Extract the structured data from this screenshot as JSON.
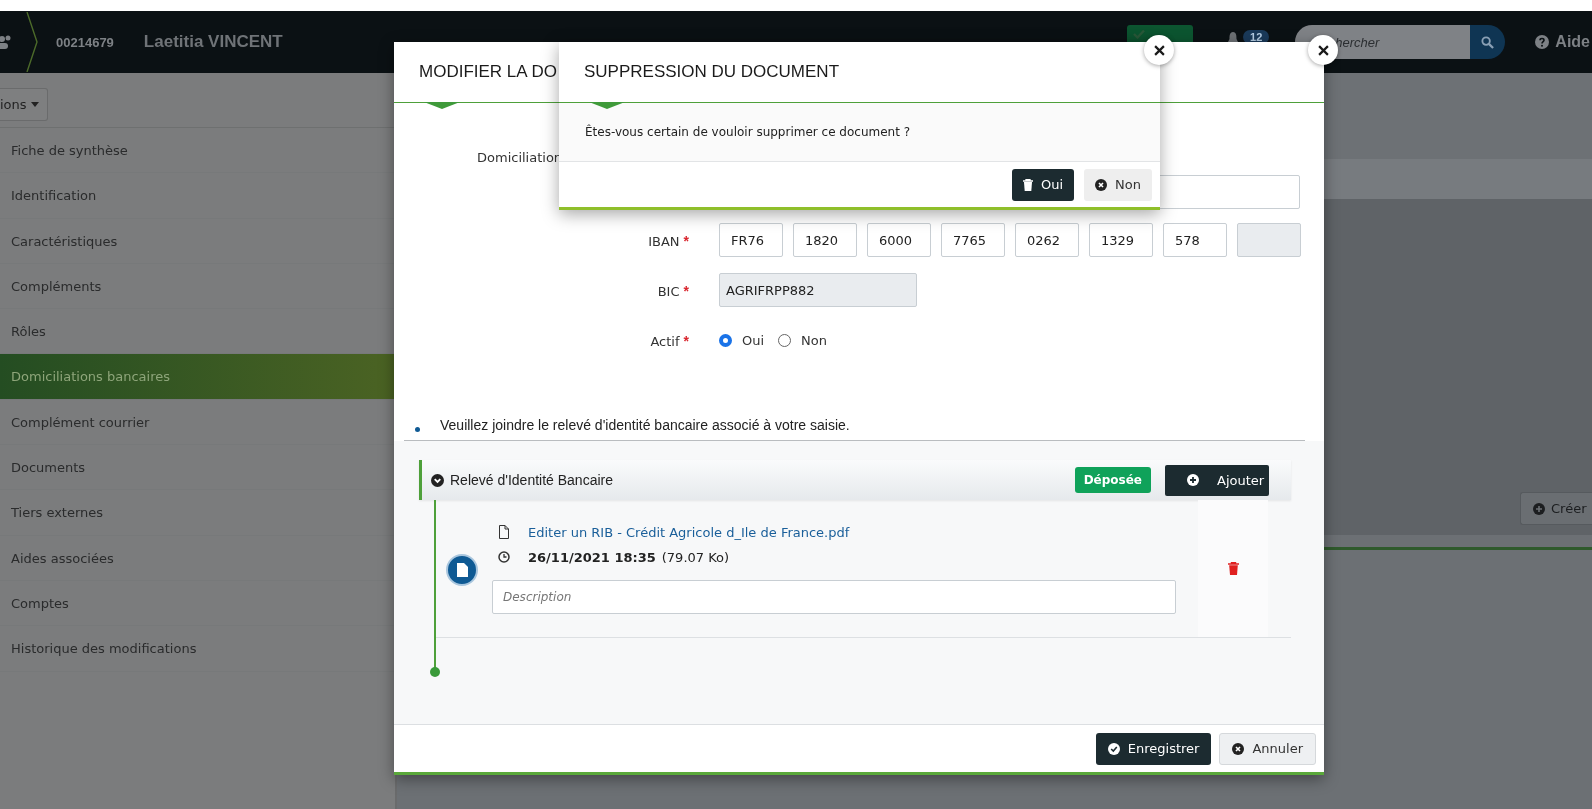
{
  "header": {
    "record_id": "00214679",
    "name": "Laetitia VINCENT",
    "notification_count": "12",
    "search": {
      "placeholder": "hercher"
    },
    "help": "Aide"
  },
  "toolbar": {
    "actions_button": "ions"
  },
  "sidebar": {
    "items": [
      {
        "label": "Fiche de synthèse",
        "selected": false
      },
      {
        "label": "Identification",
        "selected": false
      },
      {
        "label": "Caractéristiques",
        "selected": false
      },
      {
        "label": "Compléments",
        "selected": false
      },
      {
        "label": "Rôles",
        "selected": false
      },
      {
        "label": "Domiciliations bancaires",
        "selected": true
      },
      {
        "label": "Complément courrier",
        "selected": false
      },
      {
        "label": "Documents",
        "selected": false
      },
      {
        "label": "Tiers externes",
        "selected": false
      },
      {
        "label": "Aides associées",
        "selected": false
      },
      {
        "label": "Comptes",
        "selected": false
      },
      {
        "label": "Historique des modifications",
        "selected": false
      }
    ]
  },
  "background_panel": {
    "create_button": "Créer"
  },
  "edit_modal": {
    "title": "MODIFIER LA DO",
    "domiciliation": {
      "label": "Domiciliation"
    },
    "iban": {
      "label": "IBAN",
      "required_mark": "*",
      "parts": [
        {
          "value": "FR76",
          "disabled": false
        },
        {
          "value": "1820",
          "disabled": false
        },
        {
          "value": "6000",
          "disabled": false
        },
        {
          "value": "7765",
          "disabled": false
        },
        {
          "value": "0262",
          "disabled": false
        },
        {
          "value": "1329",
          "disabled": false
        },
        {
          "value": "578",
          "disabled": false
        },
        {
          "disabled": true
        }
      ]
    },
    "bic": {
      "label": "BIC",
      "required_mark": "*",
      "value": "AGRIFRPP882",
      "disabled": true
    },
    "actif": {
      "label": "Actif",
      "required_mark": "*",
      "options": [
        {
          "label": "Oui",
          "selected": true
        },
        {
          "label": "Non",
          "selected": false
        }
      ]
    },
    "notice": "Veuillez joindre le relevé d'identité bancaire associé à votre saisie.",
    "attachment": {
      "title": "Relevé d'Identité Bancaire",
      "expanded": true,
      "status": "Déposée",
      "add_button": "Ajouter",
      "documents": [
        {
          "file_name": "Editer un RIB - Crédit Agricole d_Ile de France.pdf",
          "date": "26/11/2021 18:35",
          "size": "(79.07 Ko)",
          "description_placeholder": "Description"
        }
      ]
    },
    "buttons": [
      {
        "label": "Enregistrer",
        "kind": "primary"
      },
      {
        "label": "Annuler",
        "kind": "secondary"
      }
    ]
  },
  "confirm_dialog": {
    "title": "SUPPRESSION DU DOCUMENT",
    "message": "Êtes-vous certain de vouloir supprimer ce document ?",
    "buttons": [
      {
        "label": "Oui",
        "kind": "primary"
      },
      {
        "label": "Non",
        "kind": "secondary"
      }
    ]
  }
}
